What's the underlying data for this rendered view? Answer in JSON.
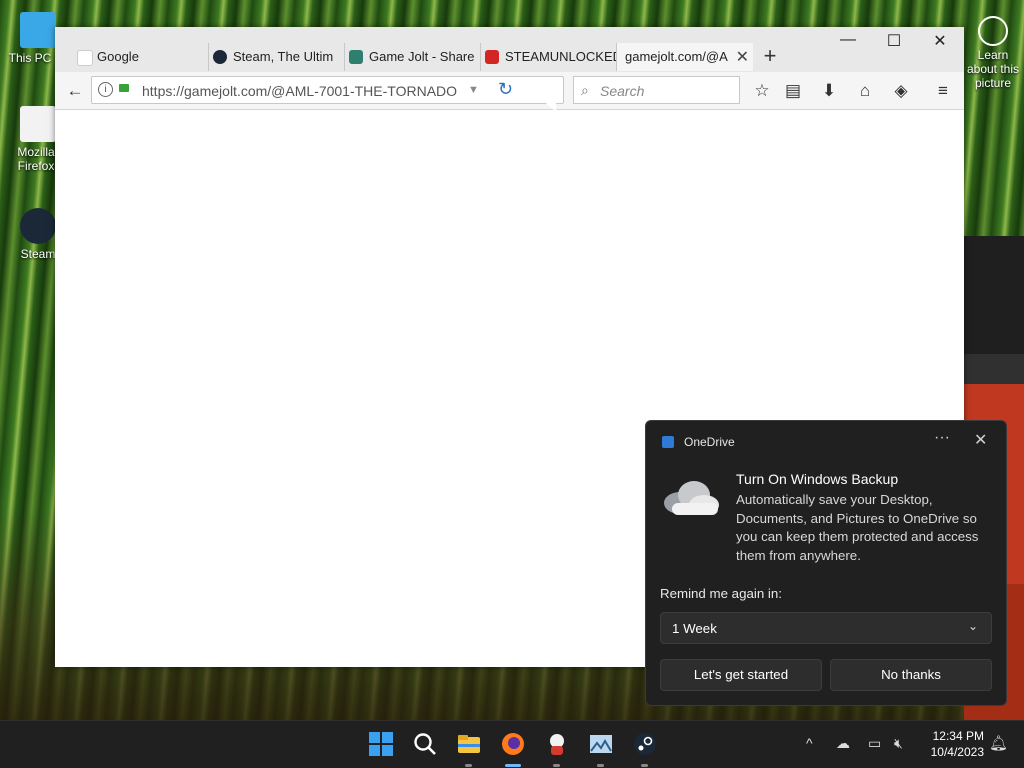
{
  "desktop": {
    "icons": [
      {
        "label": "This PC"
      },
      {
        "label": "Mozilla Firefox"
      },
      {
        "label": "Steam"
      }
    ],
    "about_picture": "Learn about this picture"
  },
  "browser": {
    "tabs": [
      {
        "label": "Google",
        "favicon": "google-favicon",
        "active": false
      },
      {
        "label": "Steam, The Ultim",
        "favicon": "steam-favicon",
        "active": false
      },
      {
        "label": "Game Jolt - Share",
        "favicon": "gamejolt-favicon",
        "active": false
      },
      {
        "label": "STEAMUNLOCKED",
        "favicon": "steamunlocked-favicon",
        "active": false
      },
      {
        "label": "gamejolt.com/@A",
        "favicon": "",
        "active": true
      }
    ],
    "url": "https://gamejolt.com/@AML-7001-THE-TORNADO",
    "search_placeholder": "Search"
  },
  "toast": {
    "app_name": "OneDrive",
    "title": "Turn On Windows Backup",
    "body": "Automatically save your Desktop, Documents, and Pictures to OneDrive so you can keep them protected and access them from anywhere.",
    "remind_label": "Remind me again in:",
    "remind_value": "1 Week",
    "primary_button": "Let's get started",
    "secondary_button": "No thanks"
  },
  "taskbar": {
    "time": "12:34 PM",
    "date": "10/4/2023"
  },
  "colors": {
    "accent": "#2f7ad6",
    "toast_bg": "#202020",
    "taskbar_bg": "#202020"
  }
}
